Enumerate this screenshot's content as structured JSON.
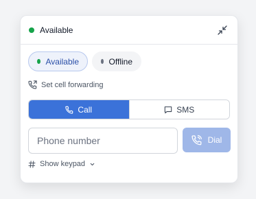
{
  "header": {
    "title": "Available",
    "status_color": "#16a34a",
    "collapse_icon": "minimize-icon"
  },
  "status_options": [
    {
      "label": "Available",
      "color": "#16a34a",
      "selected": true
    },
    {
      "label": "Offline",
      "color": "#6b7280",
      "selected": false
    }
  ],
  "forwarding": {
    "label": "Set cell forwarding",
    "icon": "phone-forward-icon"
  },
  "mode_tabs": [
    {
      "label": "Call",
      "icon": "phone-icon",
      "active": true
    },
    {
      "label": "SMS",
      "icon": "message-icon",
      "active": false
    }
  ],
  "phone_input": {
    "placeholder": "Phone number",
    "value": ""
  },
  "dial_button": {
    "label": "Dial",
    "icon": "phone-ringing-icon",
    "color": "#9fb7e8"
  },
  "keypad_toggle": {
    "label": "Show keypad",
    "icon": "hash-icon",
    "caret": "chevron-down-icon"
  },
  "accent_color": "#3b72d9"
}
